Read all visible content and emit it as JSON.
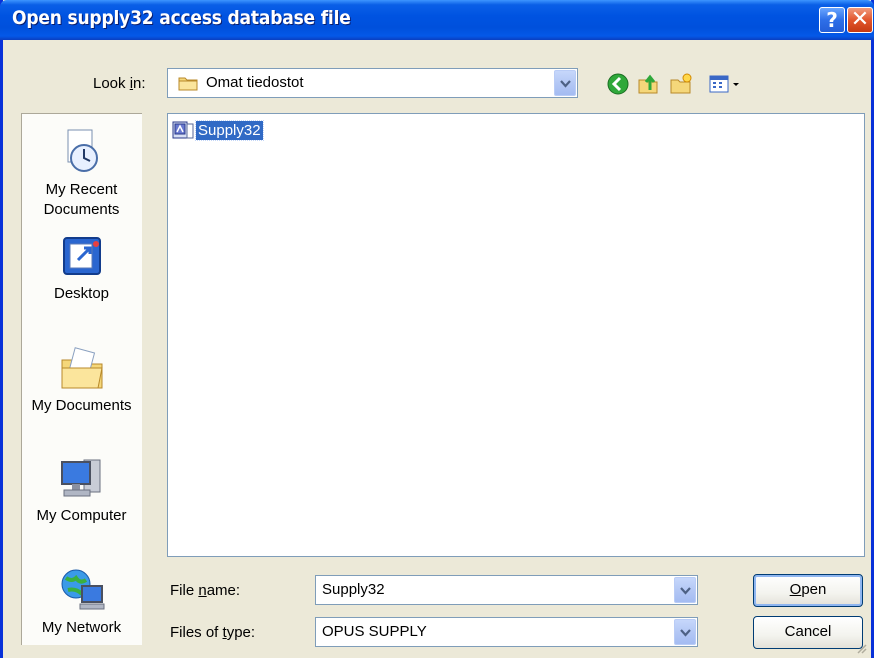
{
  "window": {
    "title": "Open supply32 access database file",
    "help_label": "?",
    "close_label": "✕"
  },
  "look_in": {
    "label": "Look in:",
    "value": "Omat tiedostot"
  },
  "toolbar": {
    "icons": [
      "back-icon",
      "up-folder-icon",
      "new-folder-icon",
      "views-menu-icon"
    ]
  },
  "places": [
    {
      "name": "My Recent Documents",
      "line1": "My Recent",
      "line2": "Documents"
    },
    {
      "name": "Desktop",
      "line1": "Desktop",
      "line2": ""
    },
    {
      "name": "My Documents",
      "line1": "My Documents",
      "line2": ""
    },
    {
      "name": "My Computer",
      "line1": "My Computer",
      "line2": ""
    },
    {
      "name": "My Network",
      "line1": "My Network",
      "line2": ""
    }
  ],
  "files": [
    {
      "name": "Supply32",
      "selected": true
    }
  ],
  "file_name": {
    "label": "File name:",
    "value": "Supply32"
  },
  "file_type": {
    "label": "Files of type:",
    "value": "OPUS SUPPLY"
  },
  "buttons": {
    "open": "Open",
    "cancel": "Cancel"
  },
  "colors": {
    "title_bar": "#0053e1",
    "selection": "#316ac5",
    "dialog_bg": "#ece9d8"
  }
}
